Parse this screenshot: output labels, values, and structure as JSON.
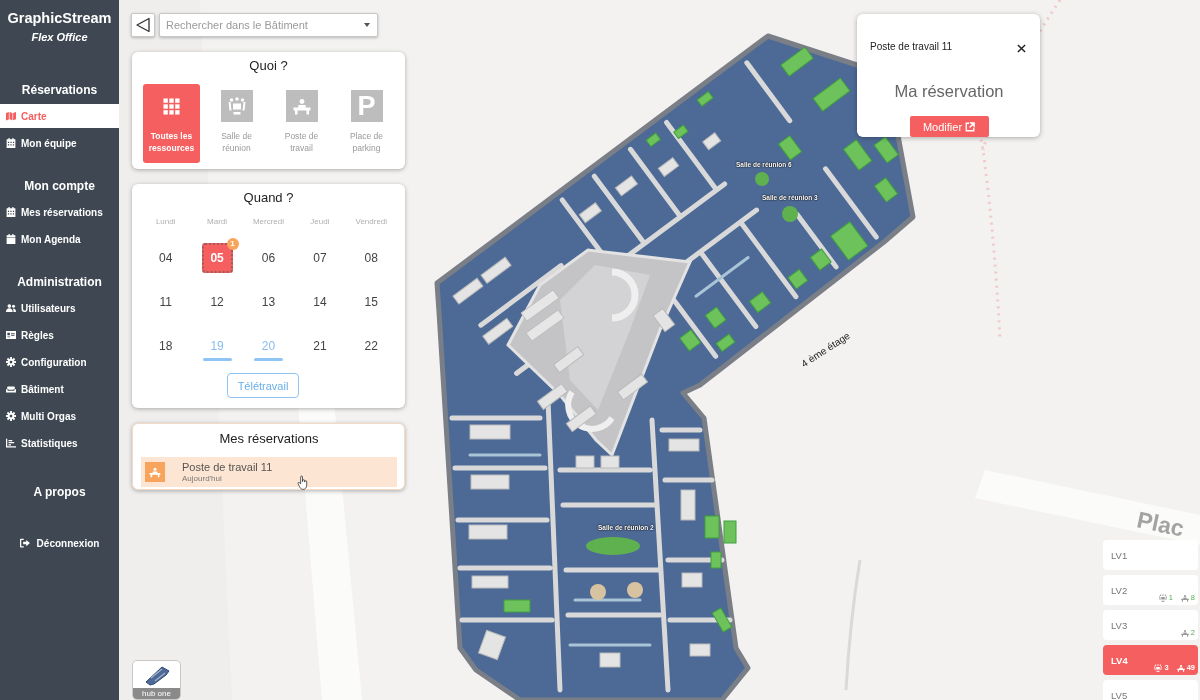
{
  "sidebar": {
    "brand": {
      "title": "GraphicStream",
      "subtitle": "Flex Office"
    },
    "sections": [
      {
        "heading": "Réservations",
        "items": [
          {
            "label": "Carte",
            "selected": true
          },
          {
            "label": "Mon équipe",
            "selected": false
          }
        ]
      },
      {
        "heading": "Mon compte",
        "items": [
          {
            "label": "Mes réservations",
            "selected": false
          },
          {
            "label": "Mon Agenda",
            "selected": false
          }
        ]
      },
      {
        "heading": "Administration",
        "items": [
          {
            "label": "Utilisateurs",
            "selected": false
          },
          {
            "label": "Règles",
            "selected": false
          },
          {
            "label": "Configuration",
            "selected": false
          },
          {
            "label": "Bâtiment",
            "selected": false
          },
          {
            "label": "Multi Orgas",
            "selected": false
          },
          {
            "label": "Statistiques",
            "selected": false
          }
        ]
      },
      {
        "heading": "A propos"
      }
    ],
    "logout": "Déconnexion"
  },
  "search": {
    "placeholder": "Rechercher dans le Bâtiment"
  },
  "what": {
    "title": "Quoi ?",
    "options": [
      {
        "label": "Toutes les ressources",
        "selected": true
      },
      {
        "label": "Salle de réunion",
        "selected": false
      },
      {
        "label": "Poste de travail",
        "selected": false
      },
      {
        "label": "Place de parking",
        "selected": false,
        "glyph": "P"
      }
    ]
  },
  "when": {
    "title": "Quand ?",
    "weekdays": [
      "Lundi",
      "Mardi",
      "Mercredi",
      "Jeudi",
      "Vendredi"
    ],
    "weeks": [
      [
        {
          "label": "04",
          "selected": false,
          "telework": false
        },
        {
          "label": "05",
          "selected": true,
          "telework": false,
          "badge": "1"
        },
        {
          "label": "06",
          "selected": false,
          "telework": false
        },
        {
          "label": "07",
          "selected": false,
          "telework": false
        },
        {
          "label": "08",
          "selected": false,
          "telework": false
        }
      ],
      [
        {
          "label": "11",
          "selected": false,
          "telework": false
        },
        {
          "label": "12",
          "selected": false,
          "telework": false
        },
        {
          "label": "13",
          "selected": false,
          "telework": false
        },
        {
          "label": "14",
          "selected": false,
          "telework": false
        },
        {
          "label": "15",
          "selected": false,
          "telework": false
        }
      ],
      [
        {
          "label": "18",
          "selected": false,
          "telework": false
        },
        {
          "label": "19",
          "selected": false,
          "telework": true
        },
        {
          "label": "20",
          "selected": false,
          "telework": true
        },
        {
          "label": "21",
          "selected": false,
          "telework": false
        },
        {
          "label": "22",
          "selected": false,
          "telework": false
        }
      ]
    ],
    "telework_button": "Télétravail"
  },
  "my_reservations": {
    "title": "Mes réservations",
    "items": [
      {
        "title": "Poste de travail 11",
        "subtitle": "Aujourd'hui"
      }
    ]
  },
  "popup": {
    "title": "Poste de travail 11",
    "message": "Ma réservation",
    "button": "Modifier"
  },
  "map": {
    "room_labels": [
      "Salle de réunion 6",
      "Salle de réunion 3",
      "Salle de réunion 2"
    ],
    "floor_label": "4 ème étage",
    "street_label": "Plac"
  },
  "levels": [
    {
      "label": "LV1",
      "selected": false
    },
    {
      "label": "LV2",
      "selected": false,
      "rooms": "1",
      "desks": "8"
    },
    {
      "label": "LV3",
      "selected": false,
      "desks": "2"
    },
    {
      "label": "LV4",
      "selected": true,
      "rooms": "3",
      "desks": "49"
    },
    {
      "label": "LV5",
      "selected": false
    }
  ],
  "minimap": {
    "label": "hub one"
  }
}
